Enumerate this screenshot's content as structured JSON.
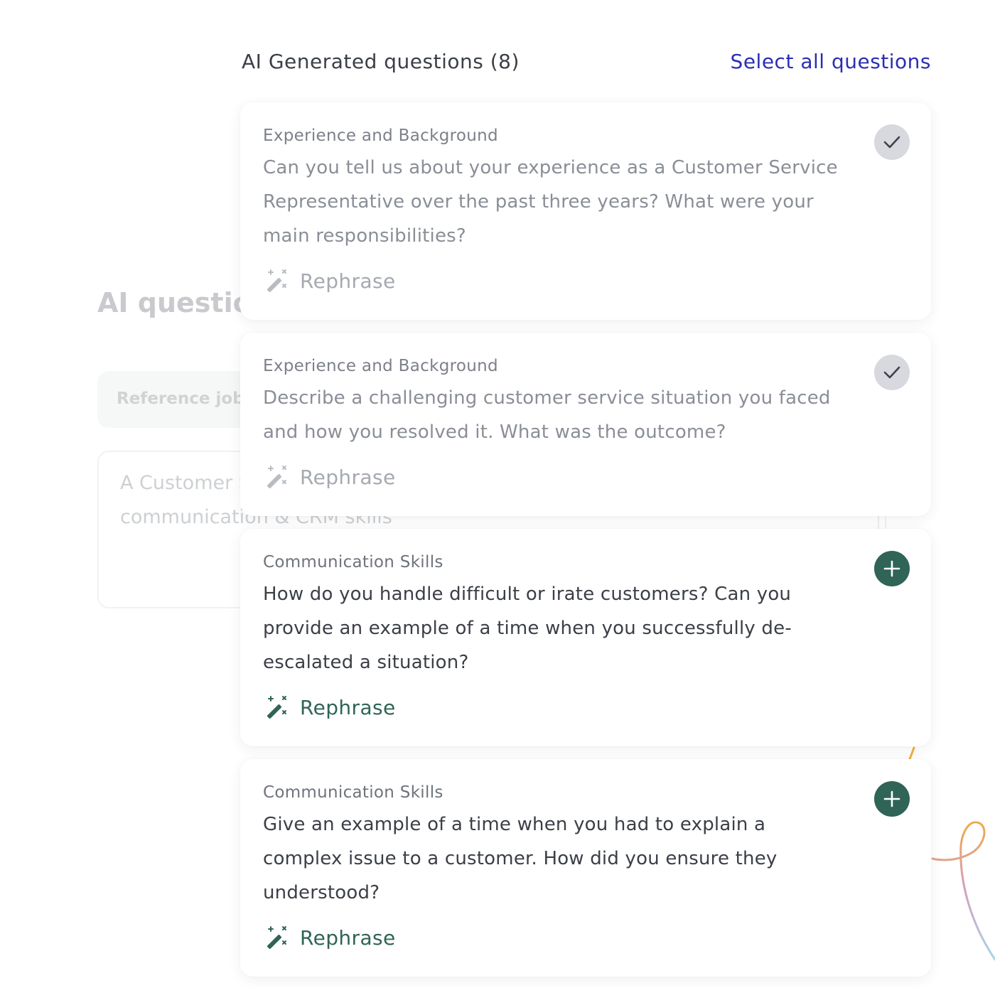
{
  "background": {
    "title": "AI questions",
    "pill_label": "Reference job",
    "textarea_text": "A Customer Service Representative with communication & CRM skills"
  },
  "panel": {
    "title": "AI Generated questions (8)",
    "select_all_label": "Select all questions"
  },
  "questions": [
    {
      "category": "Experience and Background",
      "text": "Can you tell us about your experience as a Customer Service Representative over the past three years? What were your main responsibilities?",
      "rephrase_label": "Rephrase",
      "selected": true,
      "toggle_icon": "check-icon"
    },
    {
      "category": "Experience and Background",
      "text": "Describe a challenging customer service situation you faced and how you resolved it. What was the outcome?",
      "rephrase_label": "Rephrase",
      "selected": true,
      "toggle_icon": "check-icon"
    },
    {
      "category": "Communication Skills",
      "text": "How do you handle difficult or irate customers? Can you provide an example of a time when you successfully de-escalated a situation?",
      "rephrase_label": "Rephrase",
      "selected": false,
      "toggle_icon": "plus-icon"
    },
    {
      "category": "Communication Skills",
      "text": "Give an example of a time when you had to explain a complex issue to a customer. How did you ensure they understood?",
      "rephrase_label": "Rephrase",
      "selected": false,
      "toggle_icon": "plus-icon"
    }
  ],
  "colors": {
    "accent_green": "#2f6456",
    "link_blue": "#2b2fb3",
    "selected_check_bg": "#d7d9de",
    "muted_text": "#a5a9b0"
  },
  "icons": {
    "rephrase": "magic-wand-icon"
  }
}
